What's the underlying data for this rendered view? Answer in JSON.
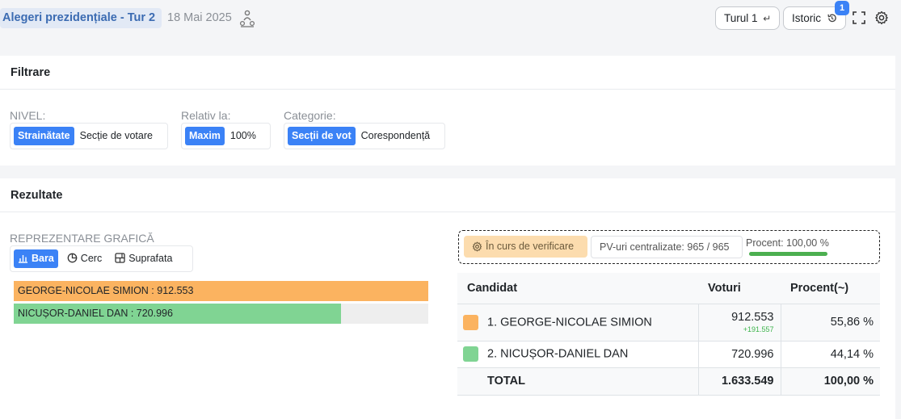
{
  "header": {
    "title": "Alegeri prezidențiale - Tur 2",
    "date": "18 Mai 2025",
    "title_icon": "people-network-icon",
    "round_button": "Turul 1",
    "round_icon": "return-arrow-icon",
    "history_button": "Istoric",
    "history_icon": "history-icon",
    "history_badge": "1",
    "fullscreen_icon": "fullscreen-icon",
    "settings_icon": "gear-icon"
  },
  "filters": {
    "title": "Filtrare",
    "nivel": {
      "label": "NIVEL:",
      "options": [
        "Strainătate",
        "Secție de votare"
      ],
      "active": "Strainătate"
    },
    "relativ": {
      "label": "Relativ la:",
      "options": [
        "Maxim",
        "100%"
      ],
      "active": "Maxim"
    },
    "categorie": {
      "label": "Categorie:",
      "options": [
        "Secții de vot",
        "Corespondență"
      ],
      "active": "Secții de vot"
    }
  },
  "results": {
    "title": "Rezultate",
    "graphic_label": "REPREZENTARE GRAFICĂ",
    "view_tabs": [
      {
        "label": "Bara",
        "icon": "bar-chart-icon",
        "active": true
      },
      {
        "label": "Cerc",
        "icon": "pie-chart-icon",
        "active": false
      },
      {
        "label": "Suprafata",
        "icon": "area-grid-icon",
        "active": false
      }
    ],
    "status": {
      "verification": "În curs de verificare",
      "verification_icon": "gear-icon",
      "pv_text": "PV-uri centralizate: 965 / 965",
      "percent_text": "Procent: 100,00 %",
      "percent_value": 100
    },
    "table": {
      "headers": [
        "Candidat",
        "Voturi",
        "Procent(~)"
      ],
      "rows": [
        {
          "name": "1. GEORGE-NICOLAE SIMION",
          "votes": "912.553",
          "delta": "+191.557",
          "percent": "55,86 %",
          "color": "#fbb360"
        },
        {
          "name": "2. NICUȘOR-DANIEL DAN",
          "votes": "720.996",
          "delta": "",
          "percent": "44,14 %",
          "color": "#80d493"
        }
      ],
      "total": {
        "label": "TOTAL",
        "votes": "1.633.549",
        "percent": "100,00 %"
      }
    }
  },
  "chart_data": {
    "type": "bar",
    "orientation": "horizontal",
    "relative_to": "Maxim",
    "categories": [
      "GEORGE-NICOLAE SIMION",
      "NICUȘOR-DANIEL DAN"
    ],
    "values": [
      912553,
      720996
    ],
    "labels": [
      "GEORGE-NICOLAE SIMION : 912.553",
      "NICUȘOR-DANIEL DAN : 720.996"
    ],
    "colors": [
      "#fbb360",
      "#80d493"
    ]
  }
}
